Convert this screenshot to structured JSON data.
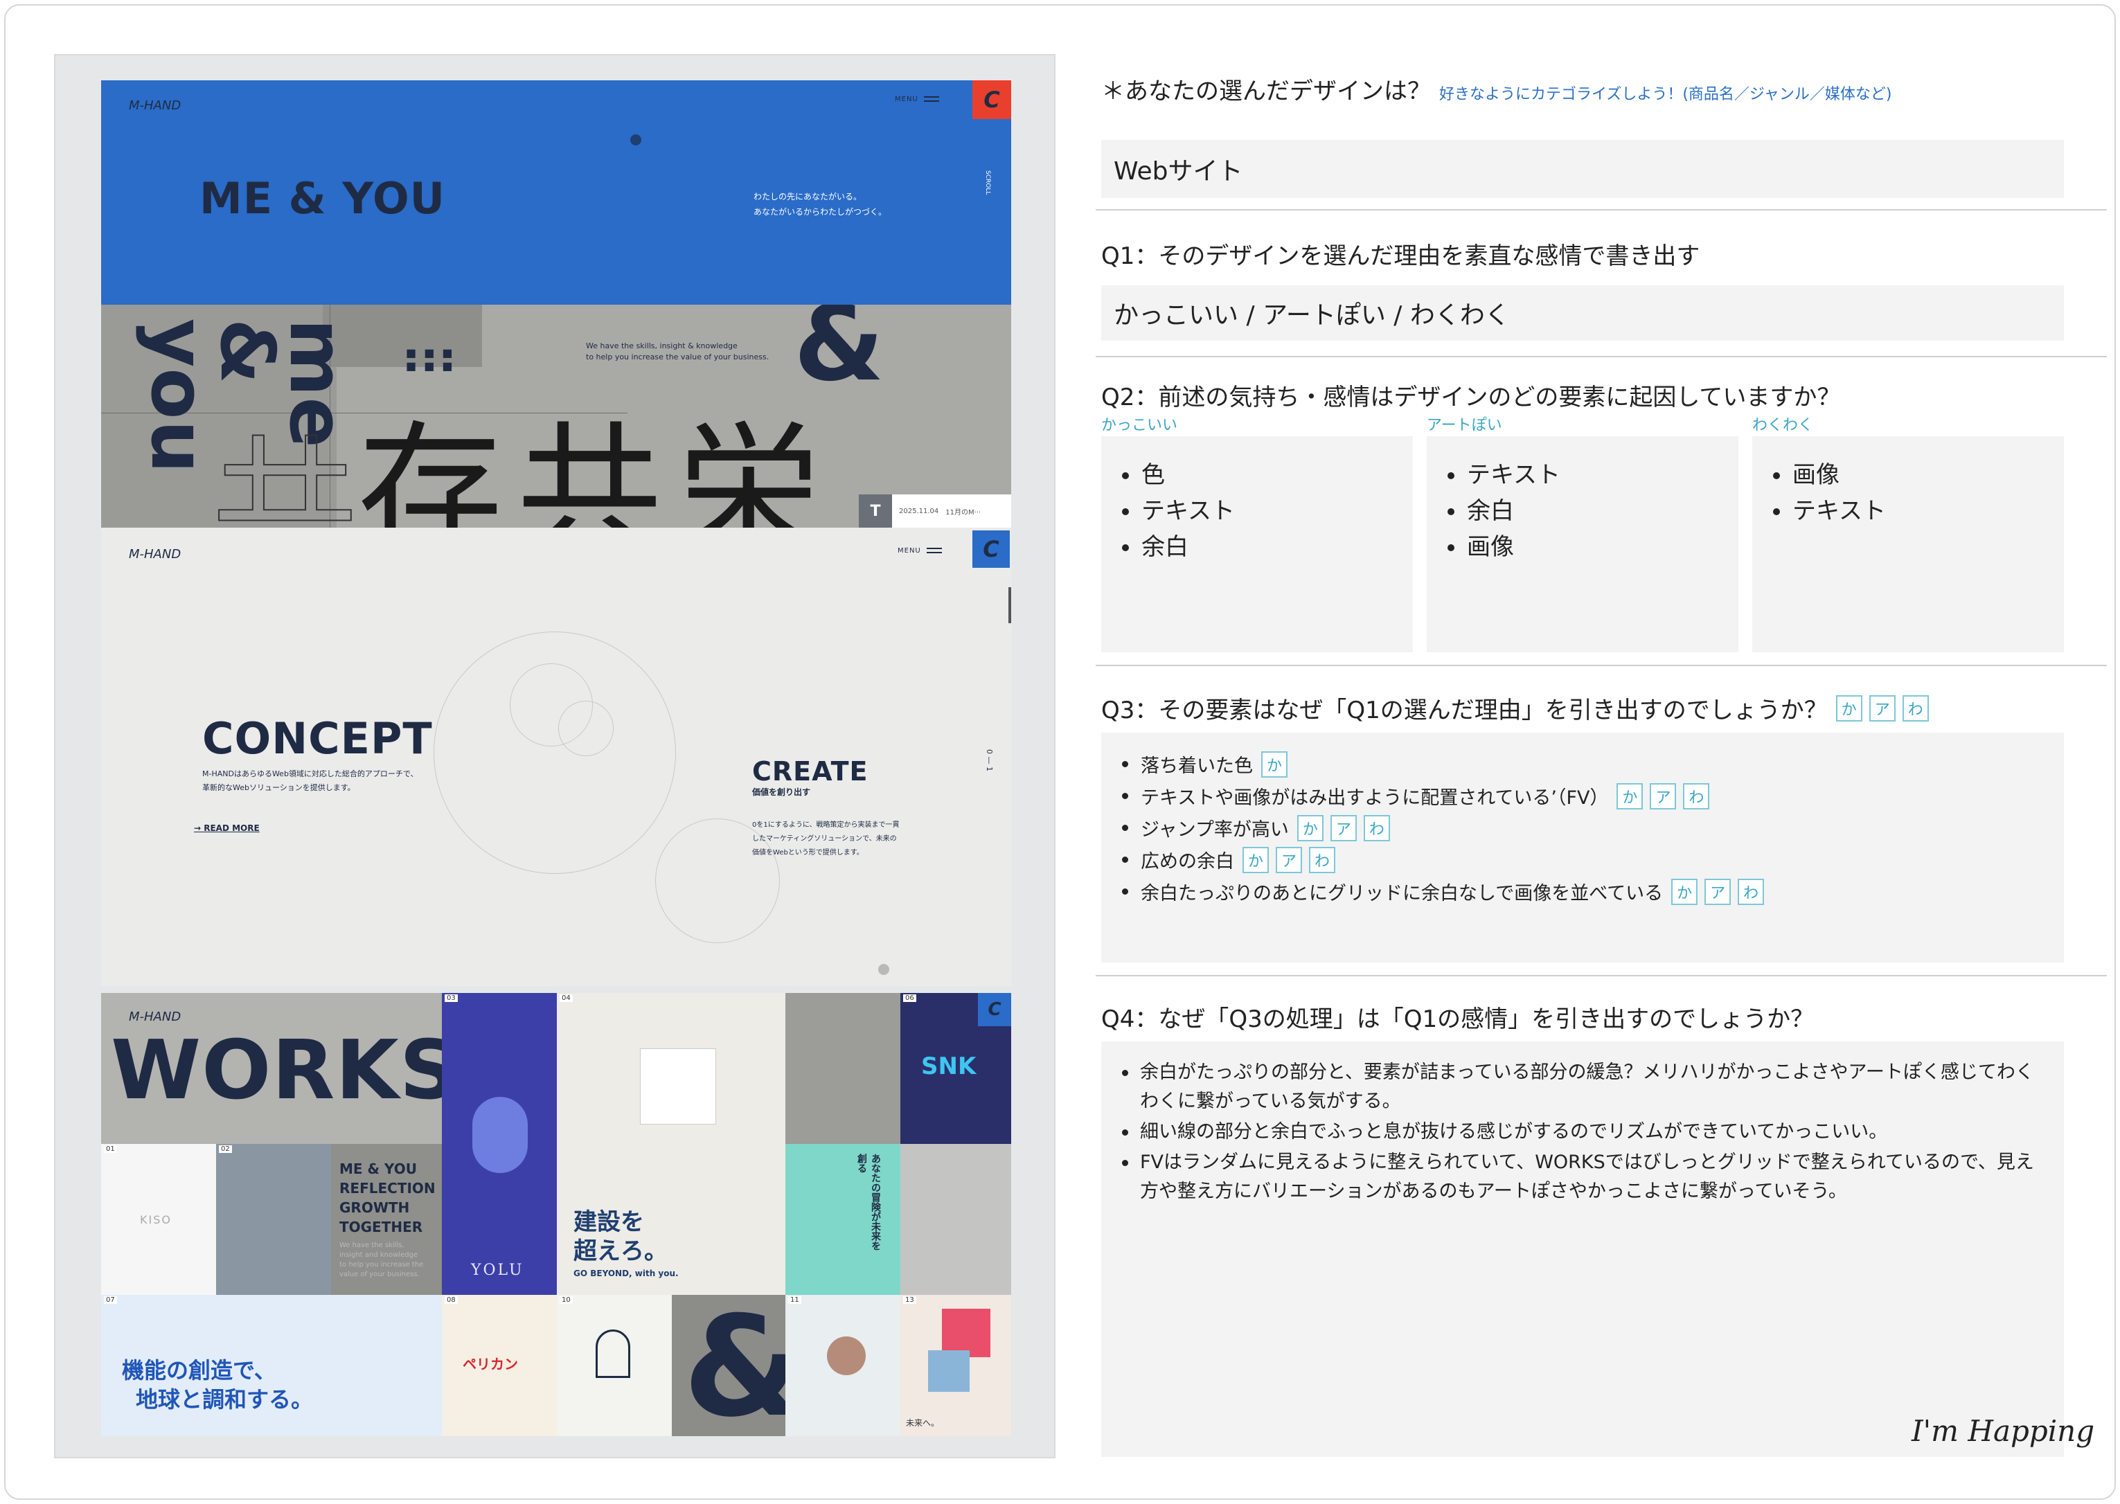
{
  "mockup": {
    "logo": "M-HAND",
    "menu_label": "MENU",
    "c_button": "C",
    "hero_title": "ME & YOU",
    "hero_copy_1": "わたしの先にあなたがいる。",
    "hero_copy_2": "あなたがいるからわたしがつづく。",
    "scroll_label": "SCROLL",
    "me_you_vertical": "me & you",
    "skills_copy_1": "We have the skills, insight & knowledge",
    "skills_copy_2": "to help you increase the value of your business.",
    "kanji": [
      "共",
      "存",
      "共",
      "栄"
    ],
    "ampersand": "&",
    "news_badge": "T",
    "news_date": "2025.11.04",
    "news_text": "11月のM···",
    "concept_title": "CONCEPT",
    "concept_text_1": "M-HANDはあらゆるWeb領域に対応した総合的アプローチで、",
    "concept_text_2": "革新的なWebソリューションを提供します。",
    "read_more": "READ MORE",
    "create_title": "CREATE",
    "create_sub": "価値を創り出す",
    "create_text_1": "0を1にするように、戦略策定から実装まで一貫",
    "create_text_2": "したマーケティングソリューションで、未来の",
    "create_text_3": "価値をWebという形で提供します。",
    "create_index": "0 — 1",
    "works_title": "WORKS",
    "works_copy": [
      "ME & YOU",
      "REFLECTION",
      "GROWTH",
      "TOGETHER"
    ],
    "works_small": [
      "We have the skills,",
      "insight and knowledge",
      "to help you increase the",
      "value of your business."
    ],
    "tile_numbers": [
      "01",
      "02",
      "03",
      "04",
      "06",
      "07",
      "08",
      "10",
      "11",
      "13"
    ],
    "kiso": "KISO",
    "yolu": "YOLU",
    "kensetsu_1": "建設を",
    "kensetsu_2": "超えろ。",
    "go_beyond": "GO BEYOND, with you.",
    "adventure": "あなたの冒険が未来を創る",
    "snk": "SNK",
    "kinou_1": "機能の創造で、",
    "kinou_2": "地球と調和する。",
    "pelikan": "ペリカン",
    "mirai": "未来へ。"
  },
  "sheet": {
    "design_q": "＊あなたの選んだデザインは？",
    "design_hint": "好きなようにカテゴライズしよう！(商品名／ジャンル／媒体など)",
    "design_answer": "Webサイト",
    "q1": "Q1：そのデザインを選んだ理由を素直な感情で書き出す",
    "q1_answer": "かっこいい / アートぽい / わくわく",
    "q2": "Q2：前述の気持ち・感情はデザインのどの要素に起因していますか？",
    "cats": [
      {
        "label": "かっこいい",
        "items": [
          "色",
          "テキスト",
          "余白"
        ]
      },
      {
        "label": "アートぽい",
        "items": [
          "テキスト",
          "余白",
          "画像"
        ]
      },
      {
        "label": "わくわく",
        "items": [
          "画像",
          "テキスト"
        ]
      }
    ],
    "q3": "Q3：その要素はなぜ「Q1の選んだ理由」を引き出すのでしょうか？",
    "tags": [
      "か",
      "ア",
      "わ"
    ],
    "q3_items": [
      {
        "text": "落ち着いた色",
        "tags": [
          "か"
        ]
      },
      {
        "text": "テキストや画像がはみ出すように配置されている’（FV）",
        "tags": [
          "か",
          "ア",
          "わ"
        ]
      },
      {
        "text": "ジャンプ率が高い",
        "tags": [
          "か",
          "ア",
          "わ"
        ]
      },
      {
        "text": "広めの余白",
        "tags": [
          "か",
          "ア",
          "わ"
        ]
      },
      {
        "text": "余白たっぷりのあとにグリッドに余白なしで画像を並べている",
        "tags": [
          "か",
          "ア",
          "わ"
        ]
      }
    ],
    "q4": "Q4：なぜ「Q3の処理」は「Q1の感情」を引き出すのでしょうか？",
    "q4_items": [
      "余白がたっぷりの部分と、要素が詰まっている部分の緩急？メリハリがかっこよさやアートぽく感じてわくわくに繋がっている気がする。",
      "細い線の部分と余白でふっと息が抜ける感じがするのでリズムができていてかっこいい。",
      "FVはランダムに見えるように整えられていて、WORKSではびしっとグリッドで整えられているので、見え方や整え方にバリエーションがあるのもアートぽさやかっこよさに繋がっていそう。"
    ],
    "signature": "I'm Happing"
  }
}
